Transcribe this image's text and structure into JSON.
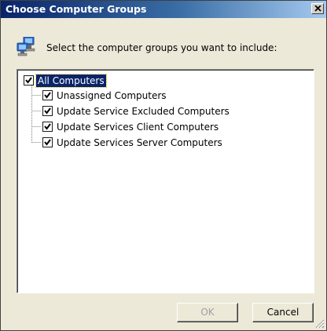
{
  "window": {
    "title": "Choose Computer Groups",
    "close_glyph": "×"
  },
  "prompt": "Select the computer groups you want to include:",
  "tree": {
    "root": {
      "label": "All Computers",
      "checked": true,
      "selected": true
    },
    "children": [
      {
        "label": "Unassigned Computers",
        "checked": true
      },
      {
        "label": "Update Service Excluded Computers",
        "checked": true
      },
      {
        "label": "Update Services Client Computers",
        "checked": true
      },
      {
        "label": "Update Services Server Computers",
        "checked": true
      }
    ]
  },
  "buttons": {
    "ok_label": "OK",
    "ok_enabled": false,
    "cancel_label": "Cancel"
  },
  "colors": {
    "title_bar": "#0a246a",
    "selection": "#0a246a",
    "dialog_face": "#ece9d8"
  }
}
